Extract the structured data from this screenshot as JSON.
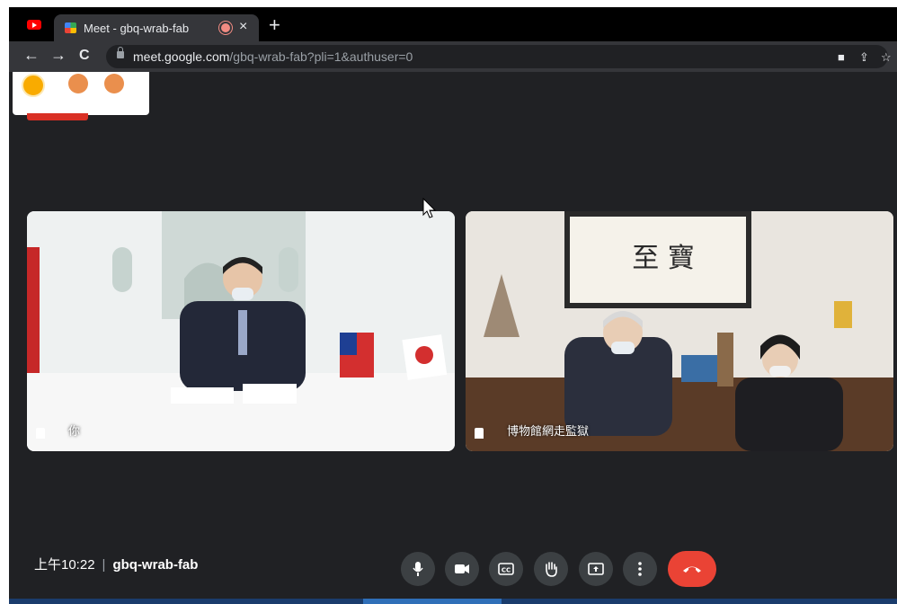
{
  "browser": {
    "tab": {
      "title": "Meet - gbq-wrab-fab",
      "close": "×"
    },
    "new_tab": "+",
    "nav": {
      "back": "←",
      "forward": "→",
      "reload": "C"
    },
    "url": {
      "host": "meet.google.com",
      "path": "/gbq-wrab-fab?pli=1&authuser=0"
    }
  },
  "participants": [
    {
      "name": "你"
    },
    {
      "name": "博物館網走監獄"
    }
  ],
  "meeting": {
    "time": "上午10:22",
    "separator": "|",
    "code": "gbq-wrab-fab"
  },
  "controls": [
    "microphone",
    "camera",
    "captions",
    "raise-hand",
    "present",
    "more-options",
    "end-call"
  ],
  "colors": {
    "end_call": "#ea4335",
    "control": "#3c4043",
    "background": "#202124"
  }
}
